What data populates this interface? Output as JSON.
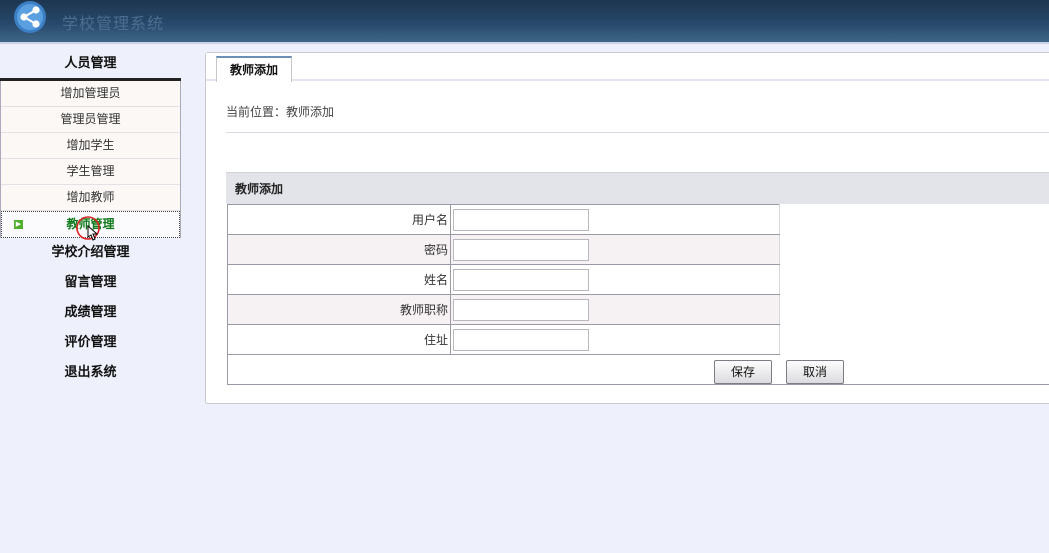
{
  "header": {
    "title": "学校管理系统"
  },
  "sidebar": {
    "sections": [
      {
        "label": "人员管理",
        "items": [
          "增加管理员",
          "管理员管理",
          "增加学生",
          "学生管理",
          "增加教师",
          "教师管理"
        ]
      },
      {
        "label": "学校介绍管理"
      },
      {
        "label": "留言管理"
      },
      {
        "label": "成绩管理"
      },
      {
        "label": "评价管理"
      },
      {
        "label": "退出系统"
      }
    ],
    "active_item": "教师管理"
  },
  "main": {
    "tab": "教师添加",
    "location": "当前位置：教师添加",
    "form": {
      "title": "教师添加",
      "fields": [
        {
          "label": "用户名",
          "value": ""
        },
        {
          "label": "密码",
          "value": ""
        },
        {
          "label": "姓名",
          "value": ""
        },
        {
          "label": "教师职称",
          "value": ""
        },
        {
          "label": "住址",
          "value": ""
        }
      ],
      "save_label": "保存",
      "cancel_label": "取消"
    }
  },
  "colors": {
    "header_bg": "#1d3650",
    "active_green": "#0f7a1c",
    "page_bg": "#eef1fb"
  }
}
